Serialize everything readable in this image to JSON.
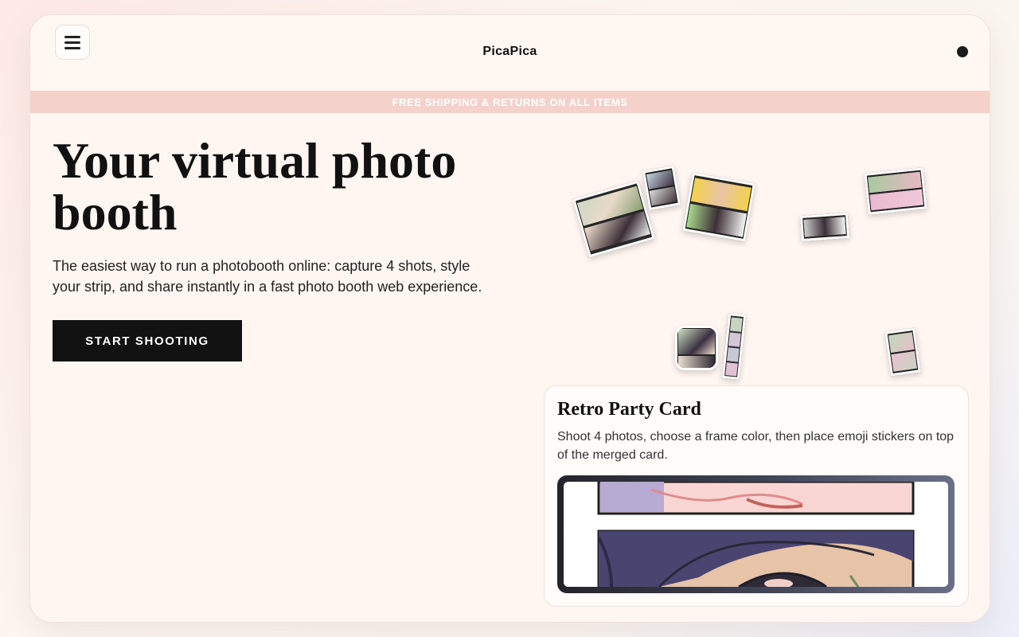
{
  "header": {
    "brand": "PicaPica",
    "menu_icon": "hamburger-menu-icon",
    "status_icon": "dot-icon"
  },
  "banner": {
    "text": "FREE SHIPPING & RETURNS ON ALL ITEMS"
  },
  "hero": {
    "title": "Your virtual photo booth",
    "subtitle": "The easiest way to run a photobooth online: capture 4 shots, style your strip, and share instantly in a fast photo booth web experience.",
    "cta_label": "START SHOOTING"
  },
  "card": {
    "title": "Retro Party Card",
    "description": "Shoot 4 photos, choose a frame color, then place emoji stickers on top of the merged card."
  },
  "colors": {
    "accent_banner": "#f4d1cb",
    "cta_bg": "#121212",
    "page_bg": "#fff6f1"
  }
}
